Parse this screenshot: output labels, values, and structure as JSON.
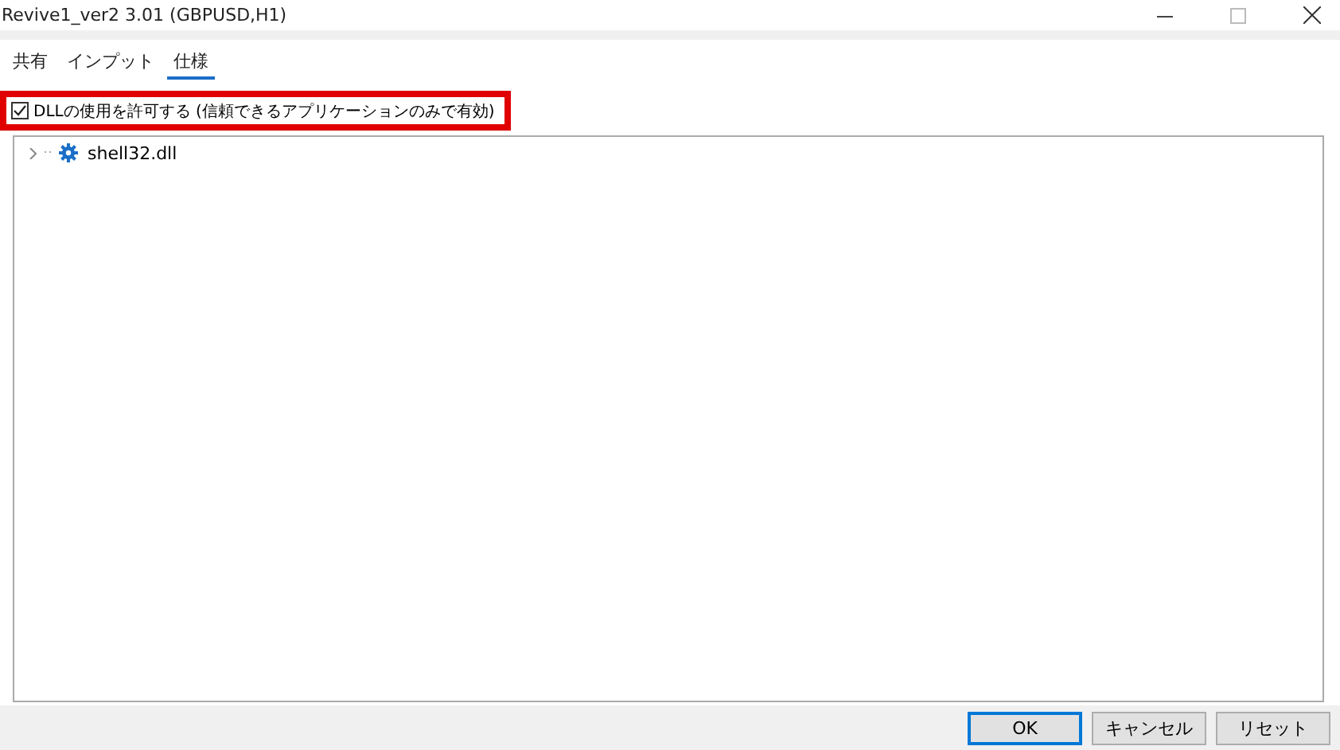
{
  "window": {
    "title": "Revive1_ver2 3.01 (GBPUSD,H1)"
  },
  "tabs": [
    {
      "label": "共有",
      "selected": false
    },
    {
      "label": "インプット",
      "selected": false
    },
    {
      "label": "仕様",
      "selected": true
    }
  ],
  "allow_dll": {
    "label": "DLLの使用を許可する (信頼できるアプリケーションのみで有効)",
    "checked": true
  },
  "tree": [
    {
      "label": "shell32.dll",
      "expanded": false
    }
  ],
  "buttons": [
    {
      "label": "OK",
      "default": true
    },
    {
      "label": "キャンセル",
      "default": false
    },
    {
      "label": "リセット",
      "default": false
    }
  ]
}
